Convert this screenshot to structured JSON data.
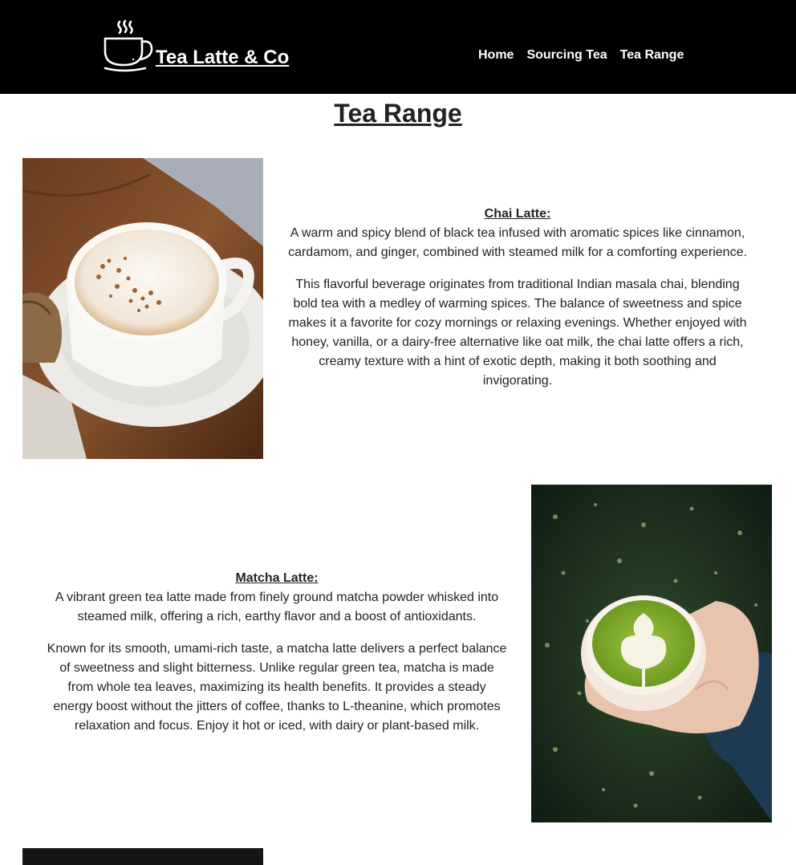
{
  "header": {
    "brand_name": "Tea Latte & Co",
    "nav": [
      "Home",
      "Sourcing Tea",
      "Tea Range"
    ]
  },
  "page": {
    "title": "Tea Range"
  },
  "products": [
    {
      "name": "Chai Latte:",
      "summary": "A warm and spicy blend of black tea infused with aromatic spices like cinnamon, cardamom, and ginger, combined with steamed milk for a comforting experience.",
      "details": "This flavorful beverage originates from traditional Indian masala chai, blending bold tea with a medley of warming spices. The balance of sweetness and spice makes it a favorite for cozy mornings or relaxing evenings. Whether enjoyed with honey, vanilla, or a dairy-free alternative like oat milk, the chai latte offers a rich, creamy texture with a hint of exotic depth, making it both soothing and invigorating."
    },
    {
      "name": "Matcha Latte:",
      "summary": "A vibrant green tea latte made from finely ground matcha powder whisked into steamed milk, offering a rich, earthy flavor and a boost of antioxidants.",
      "details": "Known for its smooth, umami-rich taste, a matcha latte delivers a perfect balance of sweetness and slight bitterness. Unlike regular green tea, matcha is made from whole tea leaves, maximizing its health benefits. It provides a steady energy boost without the jitters of coffee, thanks to L-theanine, which promotes relaxation and focus. Enjoy it hot or iced, with dairy or plant-based milk."
    }
  ]
}
